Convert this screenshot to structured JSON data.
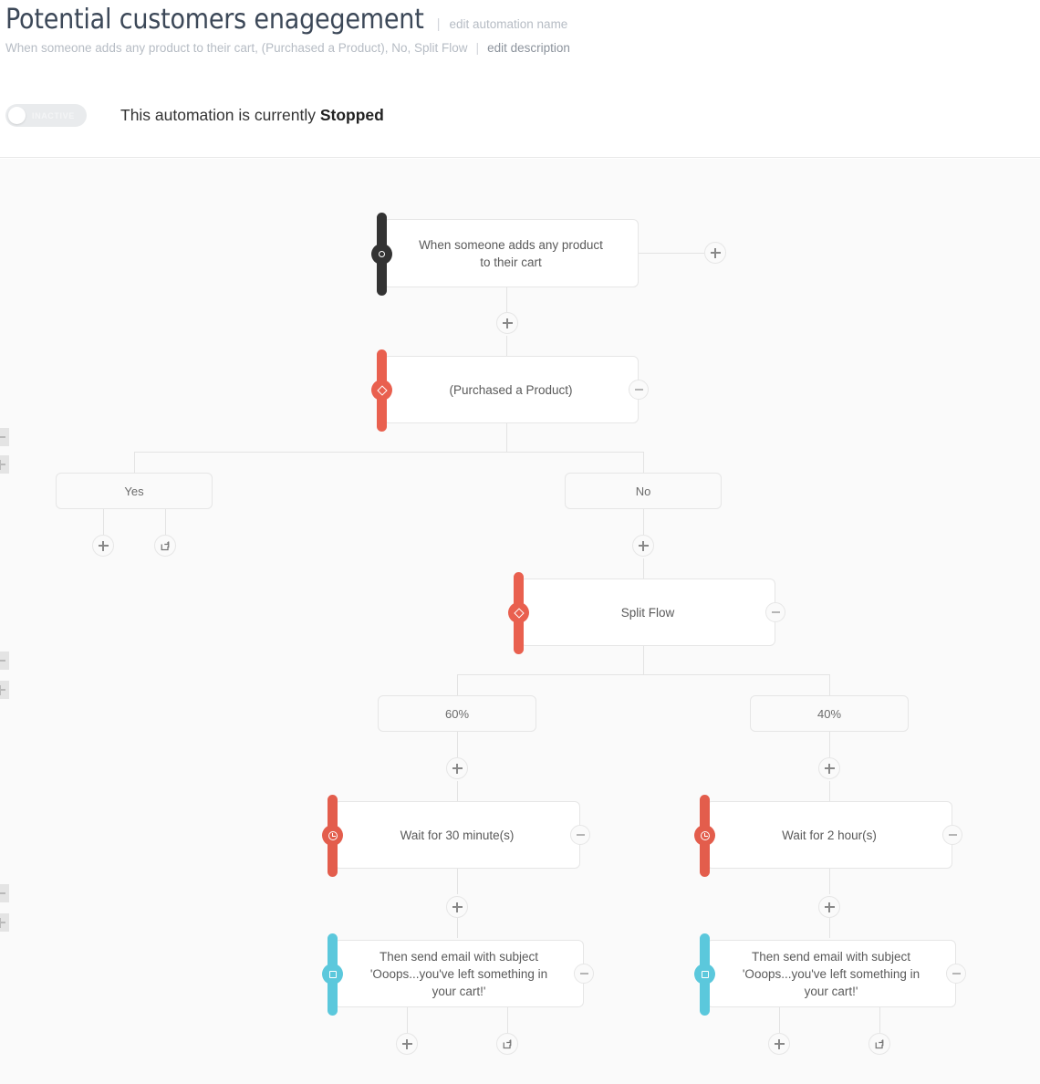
{
  "header": {
    "title": "Potential customers enagegement",
    "separator": "|",
    "edit_name_link": "edit automation name",
    "description": "When someone adds any product to their cart, (Purchased a Product), No, Split Flow",
    "edit_description_link": "edit description"
  },
  "status": {
    "toggle_label": "INACTIVE",
    "message_prefix": "This automation is currently ",
    "message_state": "Stopped"
  },
  "colors": {
    "trigger_bar": "#333333",
    "condition_bar": "#e9604f",
    "delay_bar": "#e35d4c",
    "email_bar": "#5bc8dc",
    "canvas_bg": "#fafafa",
    "connector": "#e3e3e3",
    "node_border": "#e6e6e6"
  },
  "flow": {
    "nodes": [
      {
        "id": "trigger",
        "type": "trigger",
        "label": "When someone adds any product to their cart",
        "icon": "dot-icon",
        "has_collapse": false
      },
      {
        "id": "condition",
        "type": "condition",
        "label": "(Purchased a Product)",
        "icon": "diamond-icon",
        "has_collapse": true
      },
      {
        "id": "split",
        "type": "condition",
        "label": "Split Flow",
        "icon": "diamond-icon",
        "has_collapse": true
      },
      {
        "id": "wait-left",
        "type": "delay",
        "label": "Wait for 30 minute(s)",
        "icon": "clock-icon",
        "has_collapse": true
      },
      {
        "id": "wait-right",
        "type": "delay",
        "label": "Wait for 2 hour(s)",
        "icon": "clock-icon",
        "has_collapse": true
      },
      {
        "id": "email-left",
        "type": "email",
        "label": "Then send email with subject 'Ooops...you've left something in your cart!'",
        "icon": "envelope-icon",
        "has_collapse": true
      },
      {
        "id": "email-right",
        "type": "email",
        "label": "Then send email with subject 'Ooops...you've left something in your cart!'",
        "icon": "envelope-icon",
        "has_collapse": true
      }
    ],
    "branches": [
      {
        "id": "branch-yes",
        "label": "Yes"
      },
      {
        "id": "branch-no",
        "label": "No"
      },
      {
        "id": "branch-60",
        "label": "60%"
      },
      {
        "id": "branch-40",
        "label": "40%"
      }
    ],
    "buttons": {
      "add": "add-step-button",
      "goto": "goto-step-button",
      "collapse": "collapse-button",
      "zoom_out": "zoom-out-button",
      "zoom_in": "zoom-in-button"
    }
  }
}
